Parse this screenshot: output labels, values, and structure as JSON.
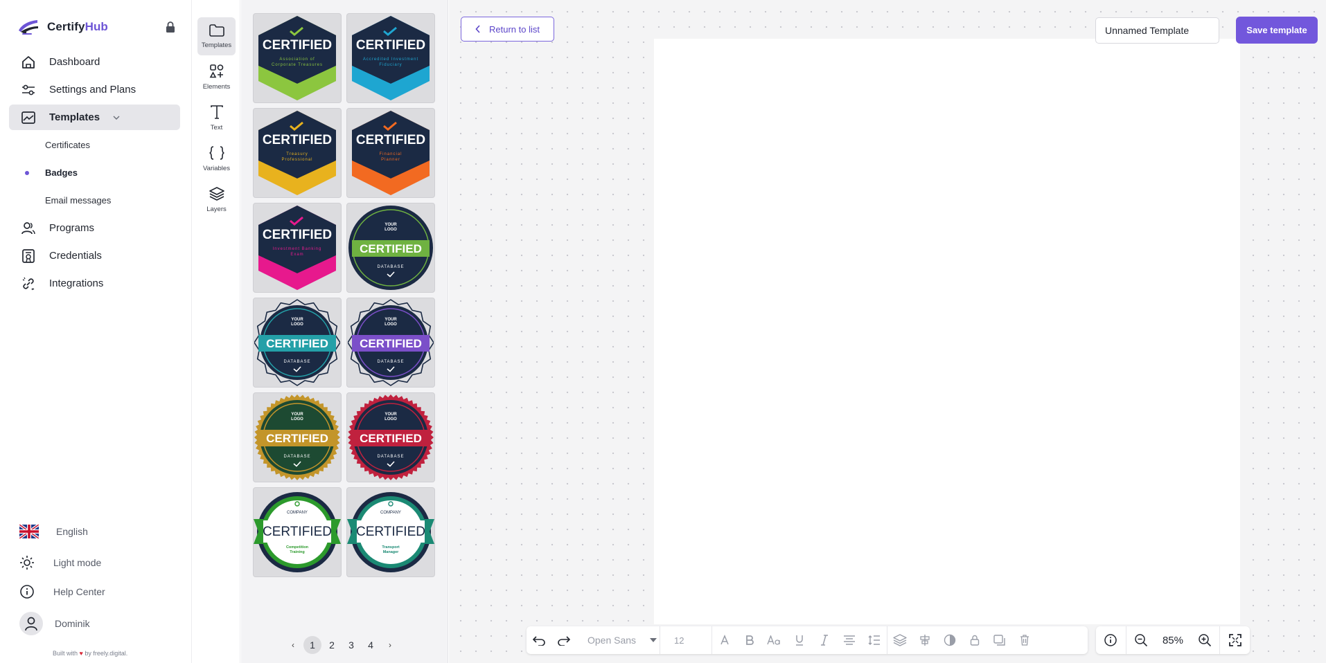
{
  "brand": {
    "name_primary": "Certify",
    "name_accent": "Hub",
    "accent_color": "#6d55d6"
  },
  "nav": {
    "dashboard": "Dashboard",
    "settings": "Settings and Plans",
    "templates": "Templates",
    "templates_sub": {
      "certificates": "Certificates",
      "badges": "Badges",
      "emails": "Email messages"
    },
    "programs": "Programs",
    "credentials": "Credentials",
    "integrations": "Integrations"
  },
  "footer": {
    "language": "English",
    "theme": "Light mode",
    "help": "Help Center",
    "user": "Dominik",
    "built_prefix": "Built with",
    "built_suffix": "by freely.digital."
  },
  "rail": {
    "templates": "Templates",
    "elements": "Elements",
    "text": "Text",
    "variables": "Variables",
    "layers": "Layers"
  },
  "badges": [
    {
      "style": "hex",
      "title": "CERTIFIED",
      "line1": "Association of",
      "line2": "Corporate Treasures",
      "accent": "#8cc63f"
    },
    {
      "style": "hex",
      "title": "CERTIFIED",
      "line1": "Accredited Investment",
      "line2": "Fiduciary",
      "accent": "#1fa6d1"
    },
    {
      "style": "hex",
      "title": "CERTIFIED",
      "line1": "Treasury",
      "line2": "Professional",
      "accent": "#e8b21e"
    },
    {
      "style": "hex",
      "title": "CERTIFIED",
      "line1": "Financial",
      "line2": "Planner",
      "accent": "#f26a21"
    },
    {
      "style": "hex",
      "title": "CERTIFIED",
      "line1": "Investment Banking",
      "line2": "Exam",
      "accent": "#e61a8d"
    },
    {
      "style": "round",
      "title": "CERTIFIED",
      "top1": "YOUR",
      "top2": "LOGO",
      "bottom": "DATABASE",
      "accent": "#6fb241",
      "edge": "plain"
    },
    {
      "style": "round",
      "title": "CERTIFIED",
      "top1": "YOUR",
      "top2": "LOGO",
      "bottom": "DATABASE",
      "accent": "#24a0a8",
      "edge": "wavy"
    },
    {
      "style": "round",
      "title": "CERTIFIED",
      "top1": "YOUR",
      "top2": "LOGO",
      "bottom": "DATABASE",
      "accent": "#7b4fc9",
      "edge": "scallop"
    },
    {
      "style": "round",
      "title": "CERTIFIED",
      "top1": "YOUR",
      "top2": "LOGO",
      "bottom": "DATABASE",
      "accent": "#c3952a",
      "edge": "teeth",
      "bg": "#1d4a32"
    },
    {
      "style": "round",
      "title": "CERTIFIED",
      "top1": "YOUR",
      "top2": "LOGO",
      "bottom": "DATABASE",
      "accent": "#c0213e",
      "edge": "teeth"
    },
    {
      "style": "ribbon",
      "title": "CERTIFIED",
      "company": "COMPANY",
      "line1": "Competition",
      "line2": "Training",
      "accent": "#2c9a2c"
    },
    {
      "style": "ribbon",
      "title": "CERTIFIED",
      "company": "COMPANY",
      "line1": "Transport",
      "line2": "Manager",
      "accent": "#1b8a74"
    }
  ],
  "pagination": {
    "pages": [
      "1",
      "2",
      "3",
      "4"
    ],
    "current": "1"
  },
  "canvas": {
    "return_label": "Return to list",
    "template_name": "Unnamed Template",
    "save_label": "Save template"
  },
  "toolbar": {
    "font": "Open Sans",
    "font_size": "12",
    "zoom": "85%"
  }
}
